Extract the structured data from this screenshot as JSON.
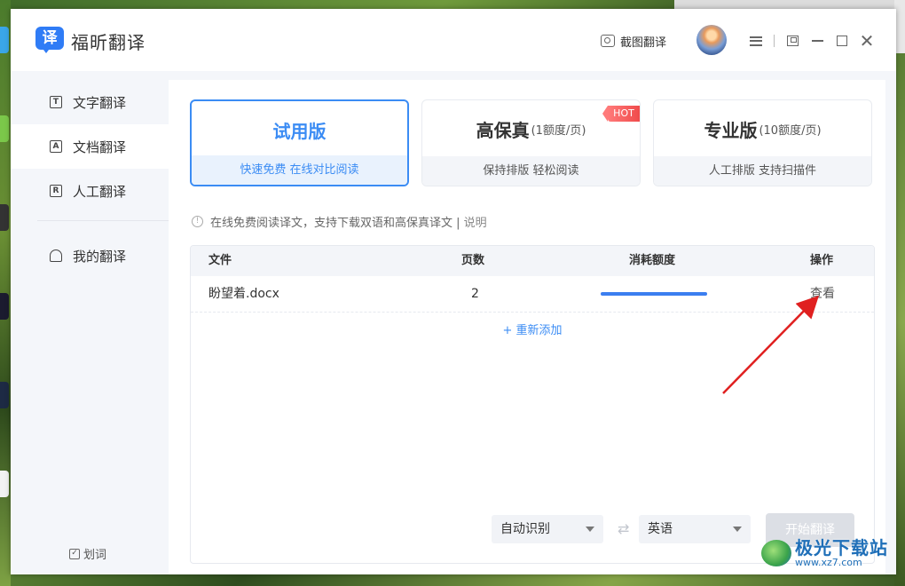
{
  "app": {
    "name": "福昕翻译",
    "logo_glyph": "译"
  },
  "toolbar": {
    "screenshot_translate": "截图翻译"
  },
  "sidebar": {
    "items": [
      {
        "label": "文字翻译",
        "icon": "T"
      },
      {
        "label": "文档翻译",
        "icon": "A"
      },
      {
        "label": "人工翻译",
        "icon": "R"
      },
      {
        "label": "我的翻译",
        "icon": ""
      }
    ],
    "huaci": {
      "label": "划词",
      "checked": true
    }
  },
  "plans": [
    {
      "title": "试用版",
      "subtitle": "",
      "footer": "快速免费 在线对比阅读",
      "badge": ""
    },
    {
      "title": "高保真",
      "subtitle": "(1额度/页)",
      "footer": "保持排版 轻松阅读",
      "badge": "HOT"
    },
    {
      "title": "专业版",
      "subtitle": "(10额度/页)",
      "footer": "人工排版 支持扫描件",
      "badge": ""
    }
  ],
  "notice": {
    "text": "在线免费阅读译文，支持下载双语和高保真译文 |",
    "link": "说明"
  },
  "table": {
    "headers": {
      "file": "文件",
      "pages": "页数",
      "quota": "消耗额度",
      "action": "操作"
    },
    "rows": [
      {
        "file": "盼望着.docx",
        "pages": "2",
        "quota_fraction": 1.0,
        "action": "查看"
      }
    ],
    "add_again": "+ 重新添加"
  },
  "controls": {
    "source_lang": "自动识别",
    "swap_glyph": "⇄",
    "target_lang": "英语",
    "start_button": "开始翻译"
  },
  "watermark": {
    "title": "极光下载站",
    "url": "www.xz7.com"
  },
  "colors": {
    "accent": "#3b8cf4",
    "hot": "#f04b4b",
    "annotation_arrow": "#e02020"
  }
}
